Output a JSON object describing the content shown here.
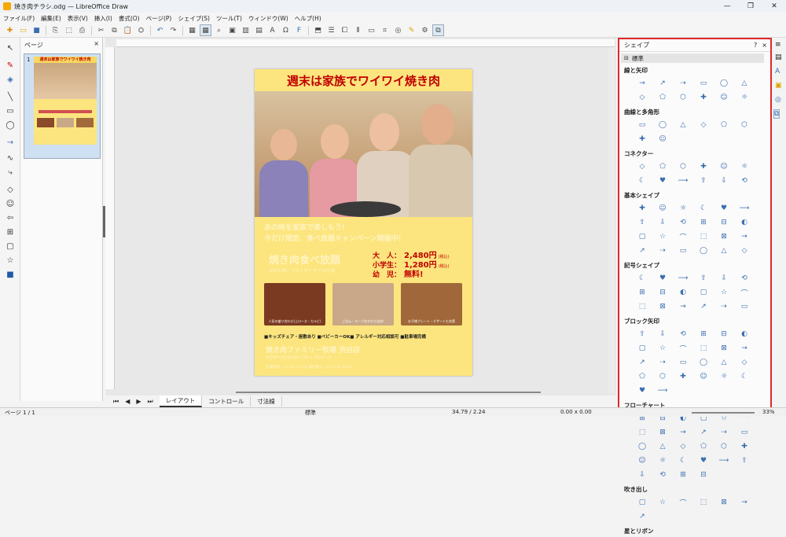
{
  "window": {
    "title": "焼き肉チラシ.odg — LibreOffice Draw"
  },
  "menu": [
    "ファイル(F)",
    "編集(E)",
    "表示(V)",
    "挿入(I)",
    "書式(O)",
    "ページ(P)",
    "シェイプ(S)",
    "ツール(T)",
    "ウィンドウ(W)",
    "ヘルプ(H)"
  ],
  "pages_panel": {
    "title": "ページ",
    "page_number": "1"
  },
  "flyer": {
    "headline": "週末は家族でワイワイ焼き肉",
    "sub1": "あの味を家族で楽しもう!",
    "sub2": "今だけ限定、食べ放題キャンペーン開催中!",
    "plan": "焼き肉食べ放題",
    "plan_note": "※90分制／ラストオーダー20分前",
    "prices": [
      {
        "label": "大　人：",
        "price": "2,480円",
        "tax": "(税込)"
      },
      {
        "label": "小学生：",
        "price": "1,280円",
        "tax": "(税込)"
      },
      {
        "label": "幼　児：",
        "price": "無料!",
        "tax": ""
      }
    ],
    "captions": [
      "人気の盛り合わせ(上ロース・カルビ)",
      "ごはん・スープおかわり自由!",
      "お子様プレート・デザートも充実"
    ],
    "features": "■キッズチェア・座敷あり ■ベビーカーOK■ アレルギー対応相談可 ■駐車場完備",
    "store": "焼き肉ファミリー牧場 渋谷店",
    "addr": "東京都渋谷区道玄坂1丁目1-1 渋谷ビル1F",
    "hours": "営業時間：11:00～23:00 電話番号：03-1234-5678"
  },
  "tabs": [
    "レイアウト",
    "コントロール",
    "寸法線"
  ],
  "sidebar": {
    "title": "シェイプ",
    "section": "標準",
    "categories": [
      {
        "name": "線と矢印",
        "count": 12
      },
      {
        "name": "曲線と多角形",
        "count": 8
      },
      {
        "name": "コネクター",
        "count": 12
      },
      {
        "name": "基本シェイプ",
        "count": 24
      },
      {
        "name": "記号シェイプ",
        "count": 18
      },
      {
        "name": "ブロック矢印",
        "count": 26
      },
      {
        "name": "フローチャート",
        "count": 28
      },
      {
        "name": "吹き出し",
        "count": 7
      },
      {
        "name": "星とリボン",
        "count": 0
      }
    ]
  },
  "status": {
    "page": "ページ 1 / 1",
    "layout": "標準",
    "pos": "34.79 / 2.24",
    "size": "0.00 x 0.00",
    "zoom": "33%"
  }
}
